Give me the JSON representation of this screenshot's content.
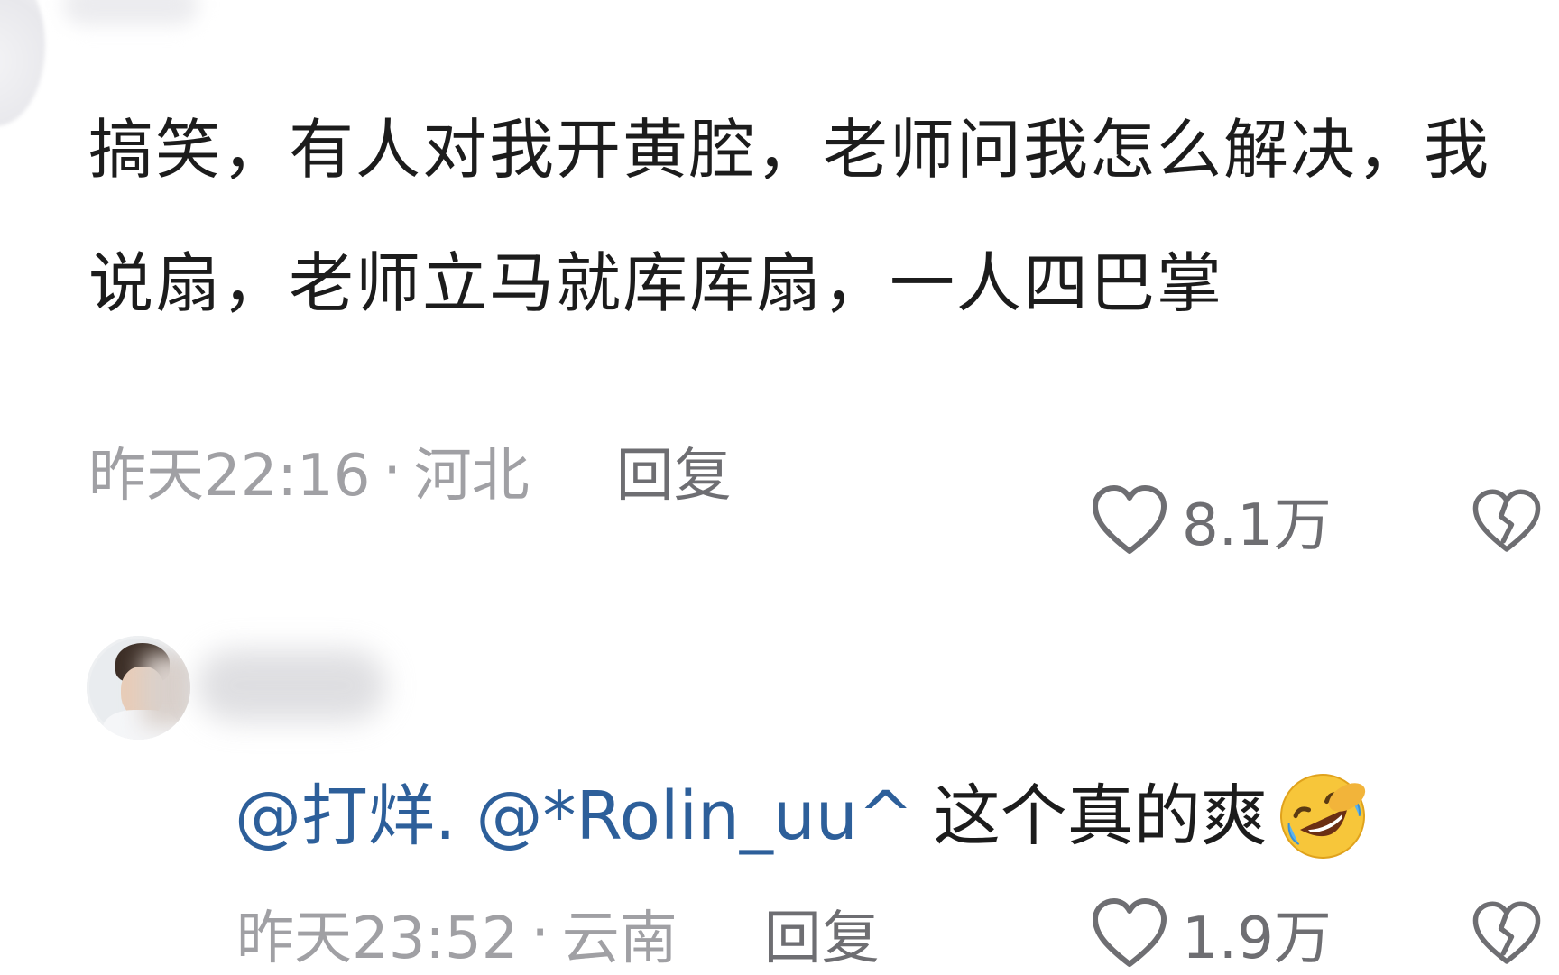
{
  "comments": [
    {
      "text": "搞笑，有人对我开黄腔，老师问我怎么解决，我说扇，老师立马就库库扇，一人四巴掌",
      "time": "昨天22:16",
      "separator": "·",
      "location": "河北",
      "reply_label": "回复",
      "likes": "8.1万",
      "icons": {
        "like": "heart-outline-icon",
        "dislike": "broken-heart-icon"
      }
    },
    {
      "mentions": [
        "@打烊.",
        "@*Rolin_uu^"
      ],
      "text": "这个真的爽",
      "emoji": "rolling-on-floor-laughing-emoji",
      "time": "昨天23:52",
      "separator": "·",
      "location": "云南",
      "reply_label": "回复",
      "likes": "1.9万",
      "icons": {
        "like": "heart-outline-icon",
        "dislike": "broken-heart-icon"
      }
    }
  ],
  "colors": {
    "mention": "#2d5f9a",
    "meta_text": "#a0a0a4",
    "action_text": "#6e6e72",
    "body_text": "#1c1c1c"
  }
}
